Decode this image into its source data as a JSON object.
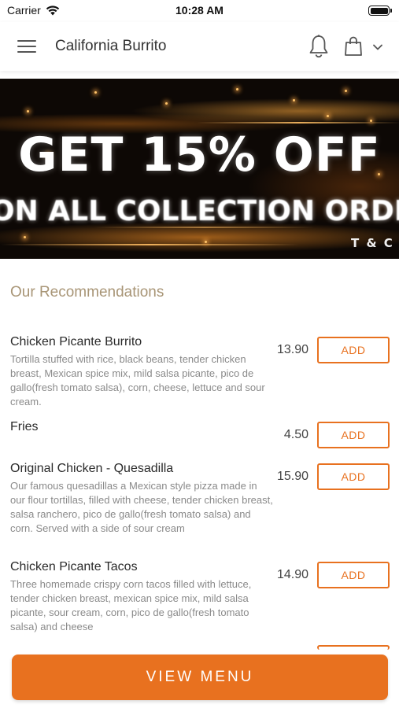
{
  "status_bar": {
    "carrier": "Carrier",
    "time": "10:28 AM"
  },
  "header": {
    "title": "California Burrito",
    "icons": [
      "menu-icon",
      "bell-icon",
      "shopping-bag-icon",
      "chevron-down-icon"
    ]
  },
  "promo_banner": {
    "headline": "GET 15% OFF",
    "subline": "ON ALL COLLECTION ORDERS",
    "terms": "T & C Apply"
  },
  "recommendations": {
    "title": "Our Recommendations",
    "items": [
      {
        "name": "Chicken Picante Burrito",
        "description": "Tortilla stuffed with rice, black beans, tender chicken breast, Mexican spice mix, mild salsa picante, pico de gallo(fresh tomato salsa), corn, cheese, lettuce and sour cream.",
        "price": "13.90",
        "add_label": "ADD"
      },
      {
        "name": "Fries",
        "description": "",
        "price": "4.50",
        "add_label": "ADD"
      },
      {
        "name": "Original Chicken - Quesadilla",
        "description": "Our famous quesadillas a Mexican style pizza made in our flour tortillas, filled with cheese, tender chicken breast, salsa ranchero, pico de gallo(fresh tomato salsa) and corn. Served with a side of sour cream",
        "price": "15.90",
        "add_label": "ADD"
      },
      {
        "name": "Chicken Picante Tacos",
        "description": "Three homemade crispy corn tacos filled with lettuce, tender chicken breast, mexican spice mix, mild salsa picante, sour cream, corn, pico de gallo(fresh tomato salsa) and cheese",
        "price": "14.90",
        "add_label": "ADD"
      }
    ]
  },
  "view_menu": {
    "label": "VIEW MENU"
  },
  "colors": {
    "accent": "#e8711f",
    "section_title": "#a89576",
    "description": "#8a8a8a",
    "banner_background": "#0d0805"
  }
}
